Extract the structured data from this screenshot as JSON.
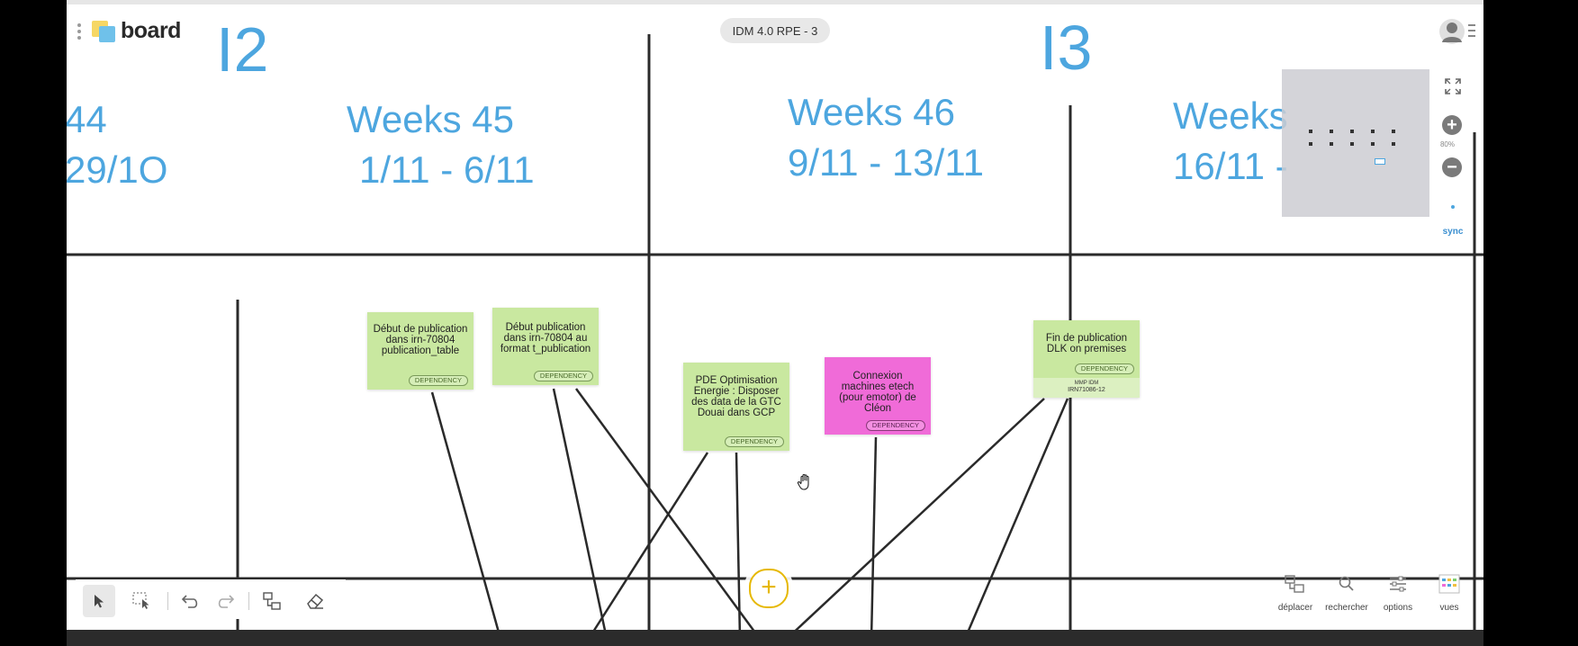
{
  "app": {
    "logo_text": "board",
    "board_title": "IDM 4.0 RPE - 3"
  },
  "iterations": [
    {
      "label": "I2"
    },
    {
      "label": "I3"
    }
  ],
  "weeks": [
    {
      "title": "44",
      "dates": "29/1O"
    },
    {
      "title": "Weeks 45",
      "dates": "1/11 - 6/11"
    },
    {
      "title": "Weeks 46",
      "dates": "9/11 - 13/11"
    },
    {
      "title": "Weeks",
      "dates": "16/11 -"
    }
  ],
  "notes": [
    {
      "text": "Début de publication dans irn-70804 publication_table",
      "tag": "DEPENDENCY",
      "color": "#c9e8a0"
    },
    {
      "text": "Début publication dans irn-70804 au format t_publication",
      "tag": "DEPENDENCY",
      "color": "#c9e8a0"
    },
    {
      "text": "PDE Optimisation Energie : Disposer des data de la GTC Douai dans GCP",
      "tag": "DEPENDENCY",
      "color": "#c9e8a0"
    },
    {
      "text": "Connexion machines etech (pour emotor) de Cléon",
      "tag": "DEPENDENCY",
      "color": "#f06bd8"
    },
    {
      "text": "Fin de publication DLK on premises",
      "tag": "DEPENDENCY",
      "color": "#c9e8a0",
      "sub_label": "MMP IDM",
      "sub_value": "IRN71086-12"
    }
  ],
  "minimap": {
    "zoom_percent": "80%",
    "sync_label": "sync"
  },
  "bottom_right_tools": [
    {
      "label": "déplacer",
      "icon": "move-icon"
    },
    {
      "label": "rechercher",
      "icon": "search-icon"
    },
    {
      "label": "options",
      "icon": "sliders-icon"
    },
    {
      "label": "vues",
      "icon": "views-icon"
    }
  ],
  "toolbar": {
    "tools": [
      "select-icon",
      "area-select-icon",
      "undo-icon",
      "redo-icon",
      "connector-icon",
      "eraser-icon"
    ]
  },
  "colors": {
    "accent_blue": "#4da6df",
    "note_green": "#c9e8a0",
    "note_pink": "#f06bd8",
    "fab_yellow": "#e6b800"
  }
}
